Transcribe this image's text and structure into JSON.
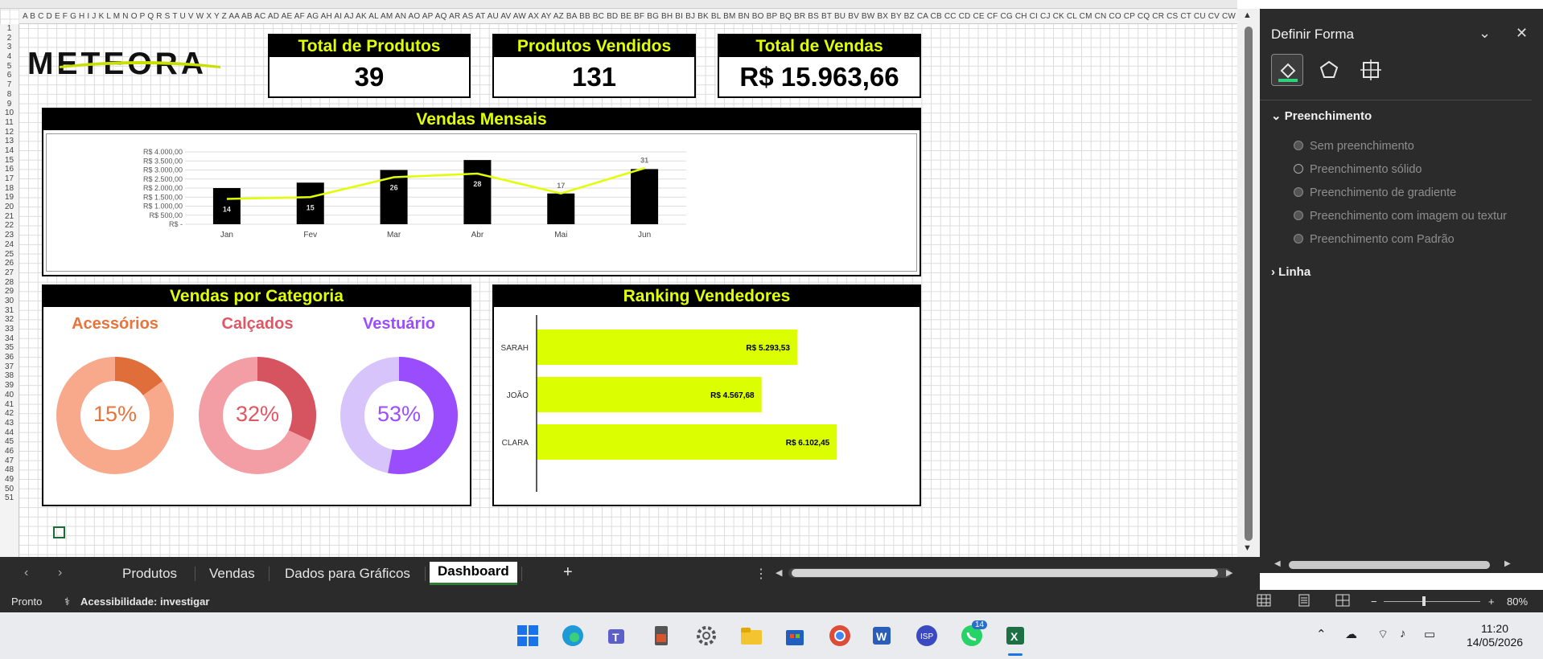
{
  "sheet": {
    "columns": "A B C D E F G H I J K L M N O P Q R S T U V W X Y Z AA AB AC AD AE AF AG AH AI AJ AK AL AM AN AO AP AQ AR AS AT AU AV AW AX AY AZ BA BB BC BD BE BF BG BH BI BJ BK BL BM BN BO BP BQ BR BS BT BU BV BW BX BY BZ CA CB CC CD CE CF CG CH CI CJ CK CL CM CN CO CP CQ CR CS CT CU CV CW CX CY CZ DA DB DC DD DE",
    "row_count": 51
  },
  "dashboard": {
    "logo_text": "METEORA",
    "kpis": [
      {
        "label": "Total de Produtos",
        "value": "39"
      },
      {
        "label": "Produtos Vendidos",
        "value": "131"
      },
      {
        "label": "Total de Vendas",
        "value": "R$  15.963,66"
      }
    ],
    "monthly": {
      "title": "Vendas Mensais"
    },
    "category": {
      "title": "Vendas por Categoria",
      "items": [
        {
          "name": "Acessórios",
          "pct_label": "15%",
          "pct": 15,
          "color": "#e8743b",
          "light": "#f8a98b",
          "dark": "#e06e3a"
        },
        {
          "name": "Calçados",
          "pct_label": "32%",
          "pct": 32,
          "color": "#e05663",
          "light": "#f29ea4",
          "dark": "#d65360"
        },
        {
          "name": "Vestuário",
          "pct_label": "53%",
          "pct": 53,
          "color": "#9b4dff",
          "light": "#d6c4fb",
          "dark": "#9a4dfd"
        }
      ]
    },
    "ranking": {
      "title": "Ranking Vendedores"
    }
  },
  "chart_data": [
    {
      "type": "bar",
      "title": "Vendas Mensais",
      "categories": [
        "Jan",
        "Fev",
        "Mar",
        "Abr",
        "Mai",
        "Jun"
      ],
      "y_ticks": [
        "R$ 4.000,00",
        "R$ 3.500,00",
        "R$ 3.000,00",
        "R$ 2.500,00",
        "R$ 2.000,00",
        "R$ 1.500,00",
        "R$ 1.000,00",
        "R$ 500,00",
        "R$ -"
      ],
      "ylim": [
        0,
        4000
      ],
      "series": [
        {
          "values": [
            2000,
            2300,
            3000,
            3550,
            1700,
            3050
          ]
        },
        {
          "type": "line",
          "values": [
            14,
            15,
            26,
            28,
            17,
            31
          ],
          "labels": [
            "14",
            "15",
            "26",
            "28",
            "17",
            "31"
          ]
        }
      ],
      "line_ylim": [
        0,
        40
      ],
      "bar_color": "#000000",
      "line_color": "#e1ff00",
      "grid": true
    },
    {
      "type": "bar",
      "orientation": "horizontal",
      "title": "Ranking Vendedores",
      "categories": [
        "SARAH",
        "JOÃO",
        "CLARA"
      ],
      "values": [
        5293.53,
        4567.68,
        6102.45
      ],
      "labels": [
        "R$ 5.293,53",
        "R$ 4.567,68",
        "R$ 6.102,45"
      ],
      "bar_color": "#dbff00",
      "xlim": [
        0,
        7000
      ]
    }
  ],
  "pane": {
    "title": "Definir Forma",
    "fill_section": "Preenchimento",
    "options": [
      "Sem preenchimento",
      "Preenchimento sólido",
      "Preenchimento de gradiente",
      "Preenchimento com imagem ou textur",
      "Preenchimento com Padrão"
    ],
    "line_section": "Linha"
  },
  "tabs": {
    "items": [
      "Produtos",
      "Vendas",
      "Dados para Gráficos"
    ],
    "active": "Dashboard",
    "add": "+"
  },
  "status": {
    "ready": "Pronto",
    "accessibility": "Acessibilidade: investigar",
    "zoom": "80%"
  },
  "taskbar": {
    "time": "11:20",
    "date": "14/05/2026",
    "whatsapp_badge": "14"
  }
}
